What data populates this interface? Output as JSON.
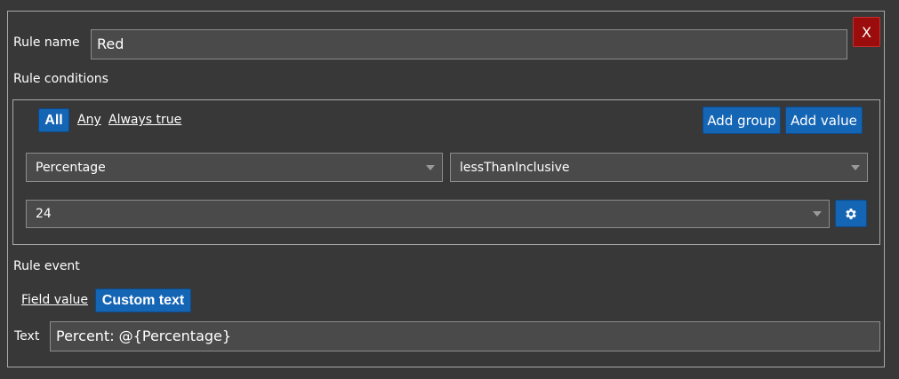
{
  "rule_name": {
    "label": "Rule name",
    "value": "Red"
  },
  "close_button": {
    "label": "X"
  },
  "conditions": {
    "label": "Rule conditions",
    "modes": {
      "all": "All",
      "any": "Any",
      "always_true": "Always true"
    },
    "active_mode": "All",
    "add_group_label": "Add group",
    "add_value_label": "Add value",
    "field_select": "Percentage",
    "operator_select": "lessThanInclusive",
    "value_select": "24"
  },
  "event": {
    "label": "Rule event",
    "field_value_label": "Field value",
    "custom_text_label": "Custom text",
    "active_option": "Custom text",
    "text_label": "Text",
    "text_value": "Percent: @{Percentage}"
  },
  "colors": {
    "background": "#383838",
    "accent_blue": "#1565b5",
    "close_red": "#9b0c0c"
  },
  "icons": {
    "settings": "gear-icon"
  }
}
